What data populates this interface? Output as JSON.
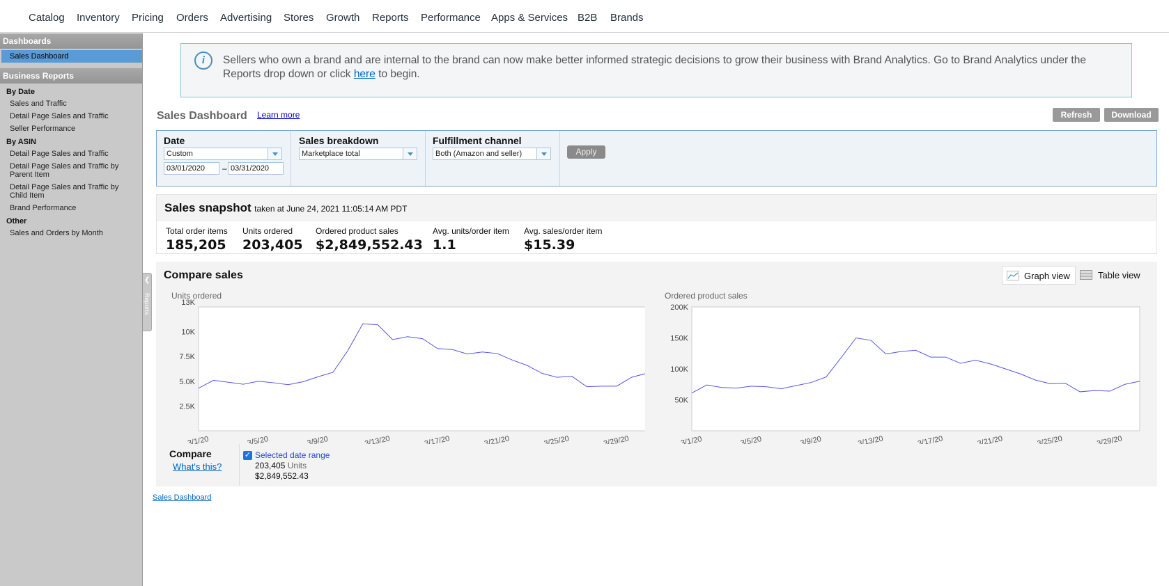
{
  "topnav": {
    "items": [
      "Catalog",
      "Inventory",
      "Pricing",
      "Orders",
      "Advertising",
      "Stores",
      "Growth",
      "Reports",
      "Performance",
      "Apps & Services",
      "B2B",
      "Brands"
    ]
  },
  "sidebar": {
    "dashboards_header": "Dashboards",
    "sales_dashboard": "Sales Dashboard",
    "business_reports_header": "Business Reports",
    "by_date": "By Date",
    "by_date_items": [
      "Sales and Traffic",
      "Detail Page Sales and Traffic",
      "Seller Performance"
    ],
    "by_asin": "By ASIN",
    "by_asin_items": [
      "Detail Page Sales and Traffic",
      "Detail Page Sales and Traffic by Parent Item",
      "Detail Page Sales and Traffic by Child Item",
      "Brand Performance"
    ],
    "other": "Other",
    "other_items": [
      "Sales and Orders by Month"
    ],
    "tab_label": "Reports"
  },
  "banner": {
    "text_before": "Sellers who own a brand and are internal to the brand can now make better informed strategic decisions to grow their business with Brand Analytics. Go to Brand Analytics under the Reports drop down or click ",
    "link": "here",
    "text_after": " to begin."
  },
  "header": {
    "title": "Sales Dashboard",
    "learn_more": "Learn more",
    "refresh": "Refresh",
    "download": "Download"
  },
  "filters": {
    "date_label": "Date",
    "date_value": "Custom",
    "date_from": "03/01/2020",
    "date_dash": "–",
    "date_to": "03/31/2020",
    "breakdown_label": "Sales breakdown",
    "breakdown_value": "Marketplace total",
    "fulfillment_label": "Fulfillment channel",
    "fulfillment_value": "Both (Amazon and seller)",
    "apply": "Apply"
  },
  "snapshot": {
    "title": "Sales snapshot",
    "taken": "taken at June 24, 2021 11:05:14 AM PDT",
    "metrics": [
      {
        "label": "Total order items",
        "value": "185,205"
      },
      {
        "label": "Units ordered",
        "value": "203,405"
      },
      {
        "label": "Ordered product sales",
        "value": "$2,849,552.43"
      },
      {
        "label": "Avg. units/order item",
        "value": "1.1"
      },
      {
        "label": "Avg. sales/order item",
        "value": "$15.39"
      }
    ]
  },
  "compare": {
    "title": "Compare sales",
    "graph_view": "Graph view",
    "table_view": "Table view",
    "compare_label": "Compare",
    "whats_this": "What's this?",
    "selected_range": "Selected date range",
    "units_value": "203,405",
    "units_word": "Units",
    "sales_value": "$2,849,552.43"
  },
  "chart_data": [
    {
      "type": "line",
      "title": "Units ordered",
      "x": [
        "3/1/20",
        "3/2/20",
        "3/3/20",
        "3/4/20",
        "3/5/20",
        "3/6/20",
        "3/7/20",
        "3/8/20",
        "3/9/20",
        "3/10/20",
        "3/11/20",
        "3/12/20",
        "3/13/20",
        "3/14/20",
        "3/15/20",
        "3/16/20",
        "3/17/20",
        "3/18/20",
        "3/19/20",
        "3/20/20",
        "3/21/20",
        "3/22/20",
        "3/23/20",
        "3/24/20",
        "3/25/20",
        "3/26/20",
        "3/27/20",
        "3/28/20",
        "3/29/20",
        "3/30/20",
        "3/31/20"
      ],
      "x_tick_labels": [
        "3/1/20",
        "3/5/20",
        "3/9/20",
        "3/13/20",
        "3/17/20",
        "3/21/20",
        "3/25/20",
        "3/29/20"
      ],
      "y_tick_labels": [
        "2.5K",
        "5.0K",
        "7.5K",
        "10K",
        "13K"
      ],
      "ylim": [
        0,
        12500
      ],
      "series": [
        {
          "values": [
            4300,
            5100,
            4900,
            4700,
            5000,
            4850,
            4650,
            4950,
            5450,
            5900,
            8100,
            10800,
            10700,
            9200,
            9500,
            9300,
            8300,
            8200,
            7750,
            7950,
            7800,
            7150,
            6600,
            5800,
            5400,
            5500,
            4450,
            4500,
            4500,
            5400,
            5800
          ]
        }
      ],
      "color": "#5555ee"
    },
    {
      "type": "line",
      "title": "Ordered product sales",
      "x": [
        "3/1/20",
        "3/2/20",
        "3/3/20",
        "3/4/20",
        "3/5/20",
        "3/6/20",
        "3/7/20",
        "3/8/20",
        "3/9/20",
        "3/10/20",
        "3/11/20",
        "3/12/20",
        "3/13/20",
        "3/14/20",
        "3/15/20",
        "3/16/20",
        "3/17/20",
        "3/18/20",
        "3/19/20",
        "3/20/20",
        "3/21/20",
        "3/22/20",
        "3/23/20",
        "3/24/20",
        "3/25/20",
        "3/26/20",
        "3/27/20",
        "3/28/20",
        "3/29/20",
        "3/30/20",
        "3/31/20"
      ],
      "x_tick_labels": [
        "3/1/20",
        "3/5/20",
        "3/9/20",
        "3/13/20",
        "3/17/20",
        "3/21/20",
        "3/25/20",
        "3/29/20"
      ],
      "y_tick_labels": [
        "50K",
        "100K",
        "150K",
        "200K"
      ],
      "ylim": [
        0,
        200000
      ],
      "series": [
        {
          "values": [
            61000,
            74000,
            70000,
            69000,
            72000,
            71000,
            68000,
            73000,
            78000,
            87000,
            118000,
            150000,
            146000,
            124000,
            128000,
            130000,
            119000,
            119000,
            109000,
            114000,
            108000,
            100000,
            92000,
            82000,
            76000,
            77000,
            63000,
            65000,
            64000,
            75000,
            80000
          ]
        }
      ],
      "color": "#5555ee"
    }
  ]
}
